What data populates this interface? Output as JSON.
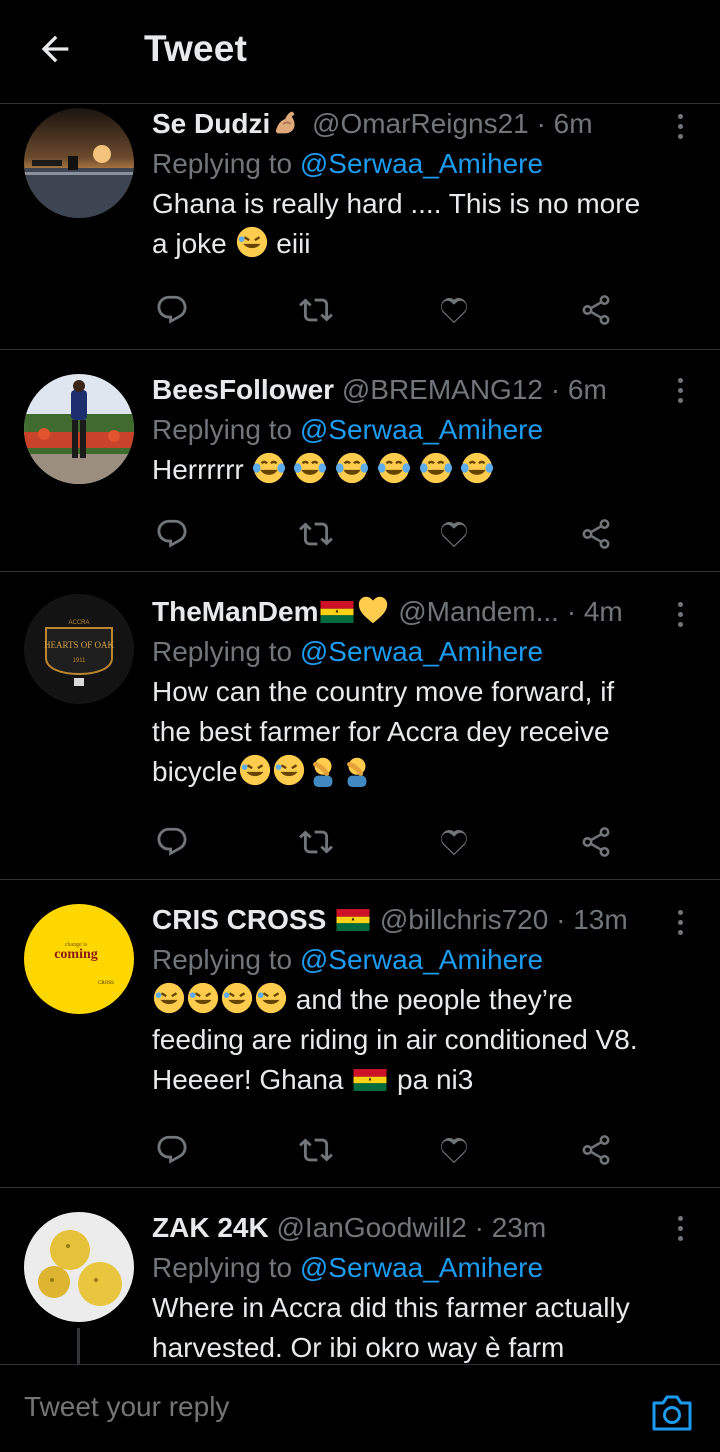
{
  "header": {
    "title": "Tweet"
  },
  "tweets": [
    {
      "name": "Se Dudzi",
      "handle": "@OmarReigns21",
      "time": "6m",
      "replying_prefix": "Replying to ",
      "replying_to": "@Serwaa_Amihere",
      "text_1": "Ghana is really hard .... This is no more",
      "text_2": "a joke",
      "text_3": "eiii"
    },
    {
      "name": "BeesFollower",
      "handle": "@BREMANG12",
      "time": "6m",
      "replying_prefix": "Replying to ",
      "replying_to": "@Serwaa_Amihere",
      "text_1": "Herrrrrr"
    },
    {
      "name": "TheManDem",
      "handle": "@Mandem...",
      "time": "4m",
      "replying_prefix": "Replying to ",
      "replying_to": "@Serwaa_Amihere",
      "text_1": "How can the country move forward, if",
      "text_2": "the best farmer for Accra dey receive",
      "text_3": "bicycle",
      "avatar_text_top": "ACCRA",
      "avatar_text_main": "HEARTS OF OAK",
      "avatar_text_year": "1911"
    },
    {
      "name": "CRIS CROSS",
      "handle": "@billchris720",
      "time": "13m",
      "replying_prefix": "Replying to ",
      "replying_to": "@Serwaa_Amihere",
      "text_1": "and the people they’re",
      "text_2": "feeding are riding in air conditioned V8.",
      "text_3": "Heeeer! Ghana",
      "text_4": "pa ni3",
      "avatar_text_small": "change is",
      "avatar_text_main": "coming",
      "avatar_text_sign": "CROSS"
    },
    {
      "name": "ZAK 24K",
      "handle": "@IanGoodwill2",
      "time": "23m",
      "replying_prefix": "Replying to ",
      "replying_to": "@Serwaa_Amihere",
      "text_1": "Where in Accra did this farmer actually",
      "text_2": "harvested. Or ibi okro way è farm"
    }
  ],
  "dot_separator": "·",
  "reply_bar": {
    "placeholder": "Tweet your reply"
  },
  "colors": {
    "accent": "#1d9bf0",
    "muted": "#71767b",
    "text": "#e7e9ea",
    "border": "#2f3336",
    "background": "#000000"
  },
  "icons": [
    "back-arrow-icon",
    "more-vertical-icon",
    "reply-icon",
    "retweet-icon",
    "like-icon",
    "share-icon",
    "camera-icon"
  ]
}
